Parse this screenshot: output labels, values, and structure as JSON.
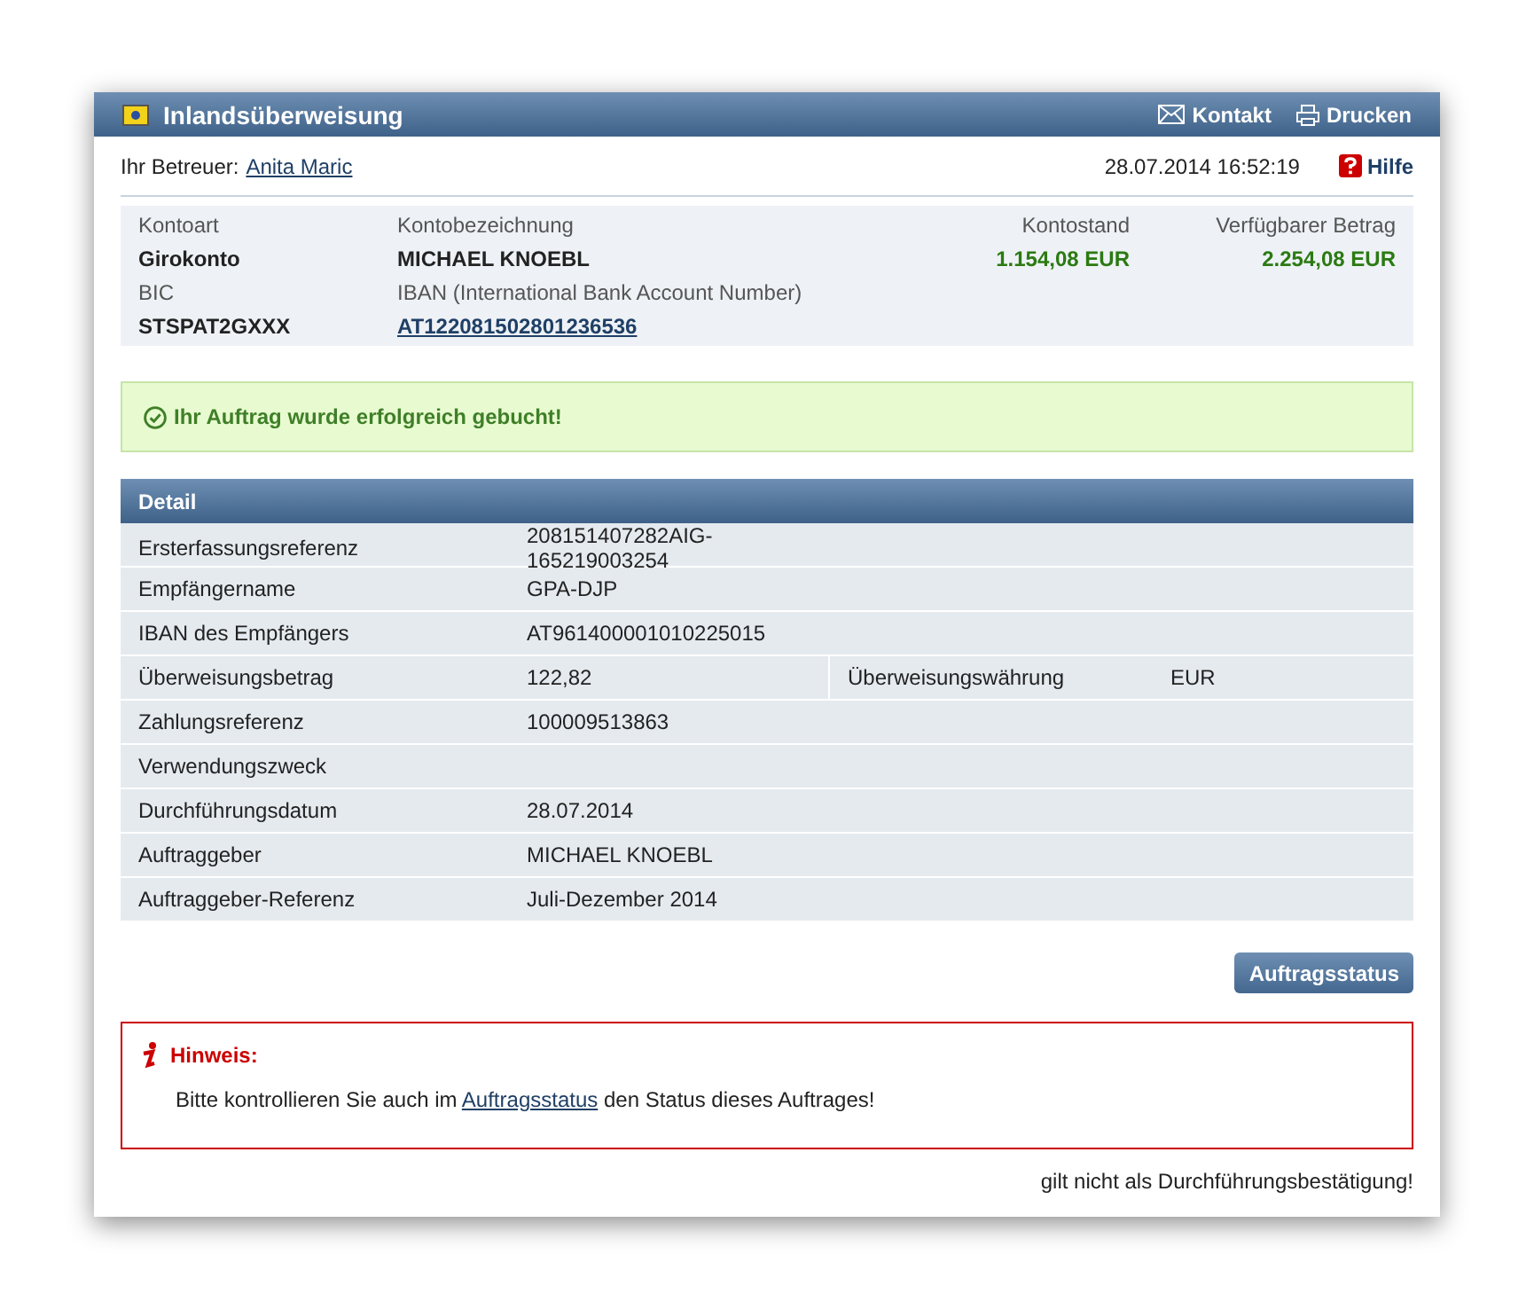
{
  "window": {
    "title": "Inlandsüberweisung"
  },
  "header_actions": [
    {
      "kind": "mail",
      "label": "Kontakt"
    },
    {
      "kind": "print",
      "label": "Drucken"
    }
  ],
  "advisor": {
    "label": "Ihr Betreuer:",
    "name": "Anita Maric"
  },
  "datetime": "28.07.2014 16:52:19",
  "help": "Hilfe",
  "account": {
    "type_label": "Kontoart",
    "type": "Girokonto",
    "name_label": "Kontobezeichnung",
    "name": "MICHAEL KNOEBL",
    "balance_label": "Kontostand",
    "balance": "1.154,08 EUR",
    "available_label": "Verfügbarer Betrag",
    "available": "2.254,08 EUR",
    "bic_label": "BIC",
    "bic": "STSPAT2GXXX",
    "iban_label": "IBAN (International Bank Account Number)",
    "iban": "AT122081502801236536"
  },
  "success_message": "Ihr Auftrag wurde erfolgreich gebucht!",
  "detail": {
    "title": "Detail",
    "rows": [
      {
        "label": "Ersterfassungsreferenz",
        "value": "208151407282AIG-165219003254"
      },
      {
        "label": "Empfängername",
        "value": "GPA-DJP"
      },
      {
        "label": "IBAN des Empfängers",
        "value": "AT961400001010225015"
      },
      {
        "label": "Überweisungsbetrag",
        "value": "122,82",
        "label_2": "Überweisungswährung",
        "value_2": "EUR"
      },
      {
        "label": "Zahlungsreferenz",
        "value": "100009513863"
      },
      {
        "label": "Verwendungszweck"
      },
      {
        "label": "Durchführungsdatum",
        "value": "28.07.2014"
      },
      {
        "label": "Auftraggeber",
        "value": "MICHAEL KNOEBL"
      },
      {
        "label": "Auftraggeber-Referenz",
        "value": "Juli-Dezember 2014"
      }
    ]
  },
  "status_button": "Auftragsstatus",
  "hint": {
    "title": "Hinweis:",
    "text_before": "Bitte kontrollieren Sie auch im",
    "link": "Auftragsstatus",
    "text_after": "den Status dieses Auftrages!"
  },
  "footer_note": "gilt nicht als Durchführungsbestätigung!"
}
